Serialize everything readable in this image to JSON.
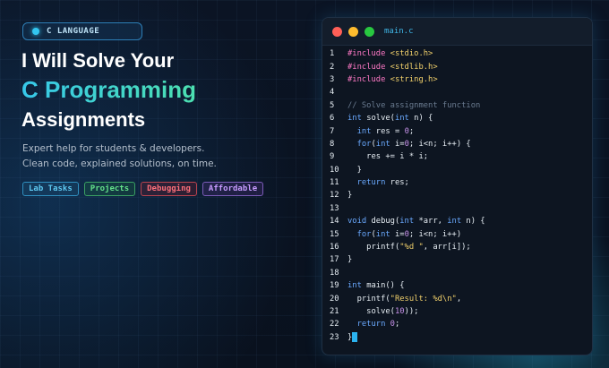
{
  "badge": {
    "label": "C LANGUAGE"
  },
  "heading": {
    "line1": "I Will Solve Your",
    "line2": "C Programming",
    "line3": "Assignments"
  },
  "subtitle": {
    "line1": "Expert help for students & developers.",
    "line2": "Clean code, explained solutions, on time."
  },
  "tags": [
    "Lab Tasks",
    "Projects",
    "Debugging",
    "Affordable"
  ],
  "colors": {
    "accent": "#3fd3c6",
    "tag_blue": "#5ec8f0",
    "tag_green": "#63e08a",
    "tag_red": "#ff6f7a",
    "tag_purple": "#c79bff"
  },
  "editor": {
    "filename": "main.c",
    "lines": [
      [
        [
          "pp",
          "#include "
        ],
        [
          "str",
          "<stdio.h>"
        ]
      ],
      [
        [
          "pp",
          "#include "
        ],
        [
          "str",
          "<stdlib.h>"
        ]
      ],
      [
        [
          "pp",
          "#include "
        ],
        [
          "str",
          "<string.h>"
        ]
      ],
      [],
      [
        [
          "com",
          "// Solve assignment function"
        ]
      ],
      [
        [
          "kw",
          "int "
        ],
        [
          "id",
          "solve("
        ],
        [
          "kw",
          "int "
        ],
        [
          "id",
          "n) {"
        ]
      ],
      [
        [
          "kw",
          "  int "
        ],
        [
          "id",
          "res = "
        ],
        [
          "num",
          "0"
        ],
        [
          "id",
          ";"
        ]
      ],
      [
        [
          "kw",
          "  for"
        ],
        [
          "id",
          "("
        ],
        [
          "kw",
          "int "
        ],
        [
          "id",
          "i="
        ],
        [
          "num",
          "0"
        ],
        [
          "id",
          "; i<n; i++) {"
        ]
      ],
      [
        [
          "id",
          "    res += i * i;"
        ]
      ],
      [
        [
          "id",
          "  }"
        ]
      ],
      [
        [
          "kw",
          "  return "
        ],
        [
          "id",
          "res;"
        ]
      ],
      [
        [
          "id",
          "}"
        ]
      ],
      [],
      [
        [
          "kw",
          "void "
        ],
        [
          "id",
          "debug("
        ],
        [
          "kw",
          "int "
        ],
        [
          "id",
          "*arr, "
        ],
        [
          "kw",
          "int "
        ],
        [
          "id",
          "n) {"
        ]
      ],
      [
        [
          "kw",
          "  for"
        ],
        [
          "id",
          "("
        ],
        [
          "kw",
          "int "
        ],
        [
          "id",
          "i="
        ],
        [
          "num",
          "0"
        ],
        [
          "id",
          "; i<n; i++)"
        ]
      ],
      [
        [
          "id",
          "    printf("
        ],
        [
          "str",
          "\"%d \""
        ],
        [
          "id",
          ", arr[i]);"
        ]
      ],
      [
        [
          "id",
          "}"
        ]
      ],
      [],
      [
        [
          "kw",
          "int "
        ],
        [
          "id",
          "main() {"
        ]
      ],
      [
        [
          "id",
          "  printf("
        ],
        [
          "str",
          "\"Result: %d\\n\""
        ],
        [
          "id",
          ","
        ]
      ],
      [
        [
          "id",
          "    solve("
        ],
        [
          "num",
          "10"
        ],
        [
          "id",
          "));"
        ]
      ],
      [
        [
          "kw",
          "  return "
        ],
        [
          "num",
          "0"
        ],
        [
          "id",
          ";"
        ]
      ],
      [
        [
          "id",
          "}"
        ]
      ]
    ]
  }
}
